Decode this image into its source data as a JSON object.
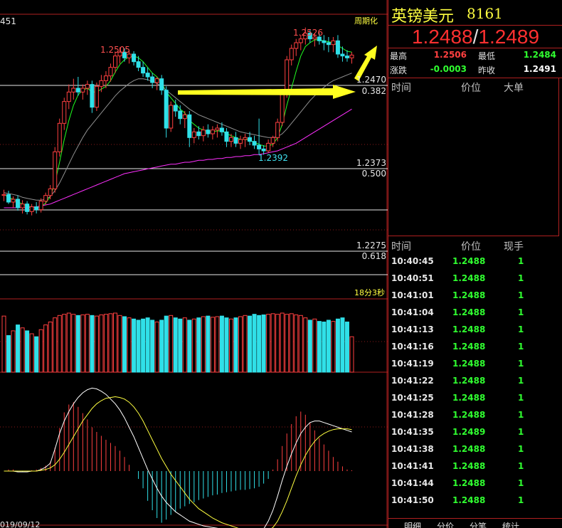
{
  "chart_data": {
    "type": "candlestick",
    "top_left_label": "451",
    "corner_label": "周期化",
    "timer_label": "18分3秒",
    "date_label": "019/09/12",
    "price_labels": {
      "peak_left": "1.2505",
      "peak_right": "1.2526",
      "low": "1.2392"
    },
    "fib_levels": [
      {
        "price": "1.2470",
        "ratio": "0.382"
      },
      {
        "price": "1.2373",
        "ratio": "0.500"
      },
      {
        "price": "1.2275",
        "ratio": "0.618"
      }
    ],
    "ohlc": [
      [
        1.2349,
        1.2355,
        1.2343,
        1.235
      ],
      [
        1.235,
        1.2354,
        1.234,
        1.2342
      ],
      [
        1.2342,
        1.2348,
        1.2336,
        1.2345
      ],
      [
        1.2345,
        1.2349,
        1.2333,
        1.2336
      ],
      [
        1.2336,
        1.2344,
        1.233,
        1.234
      ],
      [
        1.234,
        1.2343,
        1.2329,
        1.2332
      ],
      [
        1.2332,
        1.234,
        1.2328,
        1.2337
      ],
      [
        1.2337,
        1.2342,
        1.233,
        1.2334
      ],
      [
        1.2334,
        1.2346,
        1.2331,
        1.2343
      ],
      [
        1.2343,
        1.2352,
        1.2339,
        1.2349
      ],
      [
        1.2349,
        1.236,
        1.2345,
        1.2356
      ],
      [
        1.2356,
        1.24,
        1.2352,
        1.2395
      ],
      [
        1.2395,
        1.243,
        1.239,
        1.2425
      ],
      [
        1.2425,
        1.2452,
        1.2418,
        1.2448
      ],
      [
        1.2448,
        1.2466,
        1.244,
        1.2458
      ],
      [
        1.2458,
        1.2472,
        1.245,
        1.2462
      ],
      [
        1.2462,
        1.2474,
        1.2454,
        1.2458
      ],
      [
        1.2458,
        1.2466,
        1.245,
        1.2462
      ],
      [
        1.2462,
        1.247,
        1.2455,
        1.2466
      ],
      [
        1.2466,
        1.247,
        1.2436,
        1.2442
      ],
      [
        1.2442,
        1.2468,
        1.2438,
        1.2464
      ],
      [
        1.2464,
        1.2476,
        1.2458,
        1.247
      ],
      [
        1.247,
        1.248,
        1.2462,
        1.2475
      ],
      [
        1.2475,
        1.2488,
        1.2469,
        1.2484
      ],
      [
        1.2484,
        1.25,
        1.2478,
        1.2496
      ],
      [
        1.2496,
        1.2505,
        1.2488,
        1.25
      ],
      [
        1.25,
        1.2504,
        1.249,
        1.2494
      ],
      [
        1.2494,
        1.2502,
        1.2488,
        1.2498
      ],
      [
        1.2498,
        1.2501,
        1.2486,
        1.249
      ],
      [
        1.249,
        1.2496,
        1.248,
        1.2484
      ],
      [
        1.2484,
        1.249,
        1.2474,
        1.2478
      ],
      [
        1.2478,
        1.2484,
        1.247,
        1.2474
      ],
      [
        1.2474,
        1.2478,
        1.2462,
        1.2468
      ],
      [
        1.2468,
        1.2474,
        1.246,
        1.2472
      ],
      [
        1.2472,
        1.2476,
        1.2455,
        1.246
      ],
      [
        1.246,
        1.2464,
        1.241,
        1.242
      ],
      [
        1.242,
        1.2448,
        1.2416,
        1.2444
      ],
      [
        1.2444,
        1.245,
        1.2432,
        1.2438
      ],
      [
        1.2438,
        1.2444,
        1.2424,
        1.243
      ],
      [
        1.243,
        1.2438,
        1.242,
        1.2434
      ],
      [
        1.2434,
        1.2438,
        1.24,
        1.241
      ],
      [
        1.241,
        1.242,
        1.2404,
        1.2416
      ],
      [
        1.2416,
        1.2422,
        1.2408,
        1.2412
      ],
      [
        1.2412,
        1.2422,
        1.2406,
        1.2418
      ],
      [
        1.2418,
        1.2424,
        1.241,
        1.2414
      ],
      [
        1.2414,
        1.2422,
        1.2408,
        1.2418
      ],
      [
        1.2418,
        1.2424,
        1.241,
        1.242
      ],
      [
        1.242,
        1.2426,
        1.2412,
        1.2416
      ],
      [
        1.2416,
        1.242,
        1.24,
        1.2406
      ],
      [
        1.2406,
        1.2414,
        1.24,
        1.241
      ],
      [
        1.241,
        1.2416,
        1.24,
        1.2404
      ],
      [
        1.2404,
        1.2412,
        1.2398,
        1.2408
      ],
      [
        1.2408,
        1.2414,
        1.24,
        1.241
      ],
      [
        1.241,
        1.2416,
        1.2402,
        1.2406
      ],
      [
        1.2406,
        1.2412,
        1.2398,
        1.2402
      ],
      [
        1.2402,
        1.243,
        1.2392,
        1.2398
      ],
      [
        1.2398,
        1.2402,
        1.2392,
        1.2396
      ],
      [
        1.2396,
        1.2408,
        1.2394,
        1.2404
      ],
      [
        1.2404,
        1.2412,
        1.24,
        1.241
      ],
      [
        1.241,
        1.243,
        1.2406,
        1.2426
      ],
      [
        1.2426,
        1.246,
        1.2422,
        1.2456
      ],
      [
        1.2456,
        1.2496,
        1.2452,
        1.2492
      ],
      [
        1.2492,
        1.2508,
        1.2486,
        1.2504
      ],
      [
        1.2504,
        1.2514,
        1.2496,
        1.251
      ],
      [
        1.251,
        1.2518,
        1.2502,
        1.2514
      ],
      [
        1.2514,
        1.2526,
        1.2508,
        1.252
      ],
      [
        1.252,
        1.2524,
        1.251,
        1.2514
      ],
      [
        1.2514,
        1.252,
        1.2506,
        1.2516
      ],
      [
        1.2516,
        1.252,
        1.2508,
        1.2512
      ],
      [
        1.2512,
        1.2518,
        1.2502,
        1.251
      ],
      [
        1.251,
        1.2516,
        1.25,
        1.2508
      ],
      [
        1.2508,
        1.2516,
        1.25,
        1.2512
      ],
      [
        1.2512,
        1.2518,
        1.2494,
        1.2498
      ],
      [
        1.2498,
        1.2506,
        1.249,
        1.2496
      ],
      [
        1.2496,
        1.2502,
        1.249,
        1.2494
      ],
      [
        1.2494,
        1.25,
        1.2488,
        1.2497
      ]
    ],
    "ma_short": [
      1.235,
      1.2347,
      1.2345,
      1.2342,
      1.234,
      1.2338,
      1.2337,
      1.2336,
      1.2337,
      1.2341,
      1.2348,
      1.2362,
      1.2384,
      1.2408,
      1.2428,
      1.2444,
      1.2455,
      1.246,
      1.2462,
      1.2458,
      1.2458,
      1.2461,
      1.2464,
      1.247,
      1.2479,
      1.2487,
      1.2492,
      1.2495,
      1.2496,
      1.2494,
      1.249,
      1.2484,
      1.2478,
      1.2474,
      1.2468,
      1.2458,
      1.2452,
      1.2446,
      1.244,
      1.2436,
      1.2428,
      1.2424,
      1.242,
      1.2418,
      1.2416,
      1.2416,
      1.2417,
      1.2417,
      1.2414,
      1.2412,
      1.241,
      1.2408,
      1.2408,
      1.2407,
      1.2405,
      1.2403,
      1.2401,
      1.2401,
      1.2403,
      1.241,
      1.2424,
      1.2444,
      1.2462,
      1.248,
      1.2496,
      1.2506,
      1.251,
      1.2513,
      1.2513,
      1.2512,
      1.2511,
      1.251,
      1.2507,
      1.2504,
      1.2501,
      1.25
    ],
    "ma_mid": [
      1.2352,
      1.2351,
      1.235,
      1.2349,
      1.2347,
      1.2346,
      1.2345,
      1.2344,
      1.2344,
      1.2345,
      1.2348,
      1.2354,
      1.2362,
      1.2372,
      1.2382,
      1.2392,
      1.2401,
      1.241,
      1.2418,
      1.2424,
      1.243,
      1.2436,
      1.2442,
      1.2448,
      1.2454,
      1.2459,
      1.2463,
      1.2467,
      1.247,
      1.2472,
      1.2472,
      1.2471,
      1.2469,
      1.2467,
      1.2464,
      1.246,
      1.2456,
      1.2452,
      1.2448,
      1.2444,
      1.244,
      1.2437,
      1.2434,
      1.2432,
      1.243,
      1.2428,
      1.2426,
      1.2424,
      1.2422,
      1.242,
      1.2418,
      1.2416,
      1.2415,
      1.2414,
      1.2413,
      1.2412,
      1.2411,
      1.241,
      1.241,
      1.2411,
      1.2414,
      1.2419,
      1.2425,
      1.2431,
      1.2437,
      1.2443,
      1.2449,
      1.2454,
      1.2459,
      1.2463,
      1.2467,
      1.247,
      1.2472,
      1.2474,
      1.2476,
      1.2478
    ],
    "ma_long": [
      1.2336,
      1.2336,
      1.2336,
      1.2336,
      1.2336,
      1.2336,
      1.2337,
      1.2337,
      1.2338,
      1.2339,
      1.234,
      1.2342,
      1.2344,
      1.2346,
      1.2348,
      1.235,
      1.2352,
      1.2354,
      1.2356,
      1.2358,
      1.236,
      1.2362,
      1.2364,
      1.2366,
      1.2368,
      1.237,
      1.2372,
      1.2373,
      1.2374,
      1.2375,
      1.2376,
      1.2377,
      1.2378,
      1.2379,
      1.238,
      1.2381,
      1.2382,
      1.2382,
      1.2383,
      1.2384,
      1.2384,
      1.2385,
      1.2386,
      1.2386,
      1.2387,
      1.2387,
      1.2388,
      1.2388,
      1.2389,
      1.2389,
      1.239,
      1.239,
      1.2391,
      1.2391,
      1.2392,
      1.2392,
      1.2393,
      1.2394,
      1.2395,
      1.2396,
      1.2398,
      1.24,
      1.2402,
      1.2404,
      1.2407,
      1.241,
      1.2413,
      1.2416,
      1.2419,
      1.2422,
      1.2425,
      1.2428,
      1.2431,
      1.2434,
      1.2437,
      1.244
    ],
    "volume": [
      0.95,
      0.62,
      0.7,
      0.8,
      0.75,
      0.7,
      0.65,
      0.6,
      0.72,
      0.8,
      0.85,
      0.92,
      0.96,
      0.98,
      1.0,
      0.98,
      0.96,
      0.97,
      0.98,
      0.96,
      0.95,
      0.97,
      0.98,
      0.99,
      1.0,
      0.96,
      0.94,
      0.92,
      0.9,
      0.88,
      0.9,
      0.92,
      0.88,
      0.85,
      0.88,
      0.95,
      0.96,
      0.92,
      0.9,
      0.92,
      0.88,
      0.9,
      0.92,
      0.94,
      0.95,
      0.93,
      0.94,
      0.95,
      0.92,
      0.9,
      0.92,
      0.94,
      0.96,
      0.95,
      0.98,
      0.96,
      0.97,
      0.98,
      0.99,
      0.98,
      1.0,
      0.98,
      0.99,
      0.97,
      0.96,
      0.92,
      0.88,
      0.9,
      0.86,
      0.85,
      0.88,
      0.86,
      0.9,
      0.92,
      0.85,
      0.6
    ],
    "macd_hist": [
      0.0,
      0.02,
      0.02,
      0.0,
      -0.01,
      0.0,
      0.01,
      0.02,
      0.04,
      0.07,
      0.12,
      0.3,
      0.55,
      0.75,
      0.85,
      0.88,
      0.82,
      0.74,
      0.66,
      0.56,
      0.5,
      0.45,
      0.4,
      0.36,
      0.32,
      0.26,
      0.18,
      0.08,
      0.0,
      -0.1,
      -0.22,
      -0.38,
      -0.5,
      -0.6,
      -0.66,
      -0.62,
      -0.56,
      -0.52,
      -0.48,
      -0.45,
      -0.42,
      -0.4,
      -0.37,
      -0.35,
      -0.33,
      -0.31,
      -0.3,
      -0.28,
      -0.27,
      -0.26,
      -0.25,
      -0.24,
      -0.24,
      -0.23,
      -0.22,
      -0.2,
      -0.16,
      -0.1,
      0.02,
      0.15,
      0.32,
      0.48,
      0.6,
      0.7,
      0.76,
      0.72,
      0.62,
      0.52,
      0.42,
      0.34,
      0.26,
      0.18,
      0.12,
      0.06,
      0.02,
      0.01
    ],
    "macd_dif": [
      0.0,
      0.0,
      0.0,
      -0.01,
      -0.01,
      -0.01,
      0.0,
      0.0,
      0.02,
      0.05,
      0.1,
      0.28,
      0.48,
      0.64,
      0.76,
      0.86,
      0.94,
      1.0,
      1.04,
      1.06,
      1.05,
      1.02,
      0.98,
      0.92,
      0.86,
      0.78,
      0.68,
      0.56,
      0.44,
      0.3,
      0.16,
      0.02,
      -0.1,
      -0.22,
      -0.32,
      -0.4,
      -0.46,
      -0.52,
      -0.56,
      -0.6,
      -0.64,
      -0.66,
      -0.68,
      -0.7,
      -0.71,
      -0.72,
      -0.73,
      -0.74,
      -0.75,
      -0.76,
      -0.77,
      -0.78,
      -0.79,
      -0.8,
      -0.8,
      -0.78,
      -0.74,
      -0.64,
      -0.5,
      -0.32,
      -0.12,
      0.06,
      0.22,
      0.36,
      0.48,
      0.56,
      0.62,
      0.64,
      0.64,
      0.62,
      0.6,
      0.58,
      0.56,
      0.54,
      0.52,
      0.5
    ],
    "macd_dea": [
      0.0,
      0.0,
      0.0,
      0.0,
      0.0,
      0.0,
      0.0,
      0.0,
      0.01,
      0.02,
      0.04,
      0.08,
      0.15,
      0.24,
      0.34,
      0.44,
      0.54,
      0.64,
      0.72,
      0.8,
      0.86,
      0.9,
      0.93,
      0.94,
      0.95,
      0.94,
      0.92,
      0.88,
      0.82,
      0.74,
      0.64,
      0.52,
      0.4,
      0.28,
      0.16,
      0.06,
      -0.04,
      -0.12,
      -0.2,
      -0.28,
      -0.36,
      -0.42,
      -0.48,
      -0.52,
      -0.56,
      -0.6,
      -0.63,
      -0.66,
      -0.68,
      -0.7,
      -0.72,
      -0.74,
      -0.75,
      -0.76,
      -0.77,
      -0.78,
      -0.78,
      -0.76,
      -0.72,
      -0.64,
      -0.52,
      -0.38,
      -0.22,
      -0.06,
      0.08,
      0.2,
      0.3,
      0.38,
      0.44,
      0.48,
      0.51,
      0.53,
      0.54,
      0.54,
      0.54,
      0.53
    ]
  },
  "header": {
    "name": "英镑美元",
    "code": "8161"
  },
  "quote": {
    "bid": "1.2488",
    "sep": "/",
    "ask": "1.2489"
  },
  "stats": {
    "high_label": "最高",
    "high_value": "1.2506",
    "low_label": "最低",
    "low_value": "1.2484",
    "change_label": "涨跌",
    "change_value": "-0.0003",
    "prev_close_label": "昨收",
    "prev_close_value": "1.2491"
  },
  "big_orders": {
    "col_time": "时间",
    "col_price": "价位",
    "col_size": "大单"
  },
  "ticks": {
    "col_time": "时间",
    "col_price": "价位",
    "col_size": "现手",
    "rows": [
      {
        "time": "10:40:45",
        "price": "1.2488",
        "size": "1"
      },
      {
        "time": "10:40:51",
        "price": "1.2488",
        "size": "1"
      },
      {
        "time": "10:41:01",
        "price": "1.2488",
        "size": "1"
      },
      {
        "time": "10:41:04",
        "price": "1.2488",
        "size": "1"
      },
      {
        "time": "10:41:13",
        "price": "1.2488",
        "size": "1"
      },
      {
        "time": "10:41:16",
        "price": "1.2488",
        "size": "1"
      },
      {
        "time": "10:41:19",
        "price": "1.2488",
        "size": "1"
      },
      {
        "time": "10:41:22",
        "price": "1.2488",
        "size": "1"
      },
      {
        "time": "10:41:25",
        "price": "1.2488",
        "size": "1"
      },
      {
        "time": "10:41:28",
        "price": "1.2488",
        "size": "1"
      },
      {
        "time": "10:41:35",
        "price": "1.2489",
        "size": "1"
      },
      {
        "time": "10:41:38",
        "price": "1.2488",
        "size": "1"
      },
      {
        "time": "10:41:41",
        "price": "1.2488",
        "size": "1"
      },
      {
        "time": "10:41:44",
        "price": "1.2488",
        "size": "1"
      },
      {
        "time": "10:41:50",
        "price": "1.2488",
        "size": "1"
      }
    ]
  },
  "tabs": [
    "明细",
    "分价",
    "分笔",
    "统计"
  ],
  "colors": {
    "up": "#ff4040",
    "down": "#30e0e8",
    "ma_short": "#20ff20",
    "ma_mid": "#909090",
    "ma_long": "#ff30ff",
    "arrow": "#ffff20",
    "panel_border": "#b02020"
  }
}
